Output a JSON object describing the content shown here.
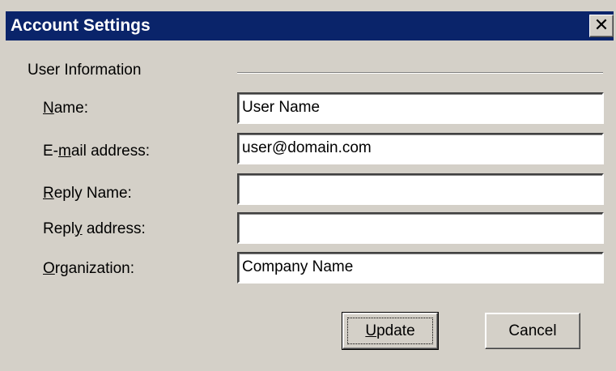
{
  "window": {
    "title": "Account Settings",
    "close_glyph": "✕"
  },
  "group": {
    "label": "User Information"
  },
  "fields": [
    {
      "label_pre": "",
      "label_accel": "N",
      "label_post": "ame:",
      "value": "User Name"
    },
    {
      "label_pre": "E-",
      "label_accel": "m",
      "label_post": "ail address:",
      "value": "user@domain.com"
    },
    {
      "label_pre": "",
      "label_accel": "R",
      "label_post": "eply Name:",
      "value": ""
    },
    {
      "label_pre": "Repl",
      "label_accel": "y",
      "label_post": " address:",
      "value": ""
    },
    {
      "label_pre": "",
      "label_accel": "O",
      "label_post": "rganization:",
      "value": "Company Name"
    }
  ],
  "buttons": {
    "update_accel": "U",
    "update_rest": "pdate",
    "cancel": "Cancel"
  },
  "colors": {
    "titlebar": "#0a246a",
    "window_bg": "#d4d0c8"
  },
  "icons": {
    "close": "close-icon"
  }
}
